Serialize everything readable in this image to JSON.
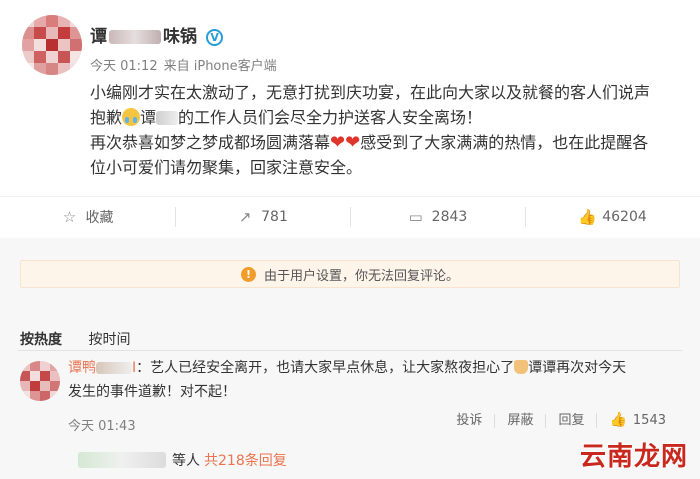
{
  "post": {
    "author_prefix": "谭",
    "author_middle": "味",
    "author_suffix": "锅",
    "verified_mark": "V",
    "time": "今天 01:12",
    "source": "来自 iPhone客户端",
    "lines": [
      "小编刚才实在太激动了，无意打扰到庆功宴，在此向大家以及就餐的客人们说声",
      "抱歉",
      "谭",
      "的工作人员们会尽全力护送客人安全离场！",
      "再次恭喜如梦之梦成都场圆满落幕",
      "感受到了大家满满的热情，也在此提醒各",
      "位小可爱们请勿聚集，回家注意安全。"
    ],
    "hearts": "❤❤"
  },
  "actions": {
    "favorite": "收藏",
    "repost": "781",
    "comment": "2843",
    "like": "46204"
  },
  "notice": {
    "text": "由于用户设置，你无法回复评论。"
  },
  "sort": {
    "hot": "按热度",
    "time": "按时间"
  },
  "comment": {
    "name_prefix": "谭鸭",
    "name_suffix": "I",
    "text_1": "：艺人已经安全离开，也请大家早点休息，让大家熬夜担心了",
    "text_2": "谭谭再次对今天",
    "text_3": "发生的事件道歉！对不起！",
    "time": "今天 01:43",
    "report": "投诉",
    "block": "屏蔽",
    "reply": "回复",
    "likes": "1543"
  },
  "replies": {
    "suffix": "等人",
    "count": "共218条回复"
  },
  "watermark": "云南龙网",
  "colors": {
    "accent": "#eb7350",
    "verified": "#2a9dd8",
    "notice_bg": "#fdf4ea",
    "warn": "#f29d2b"
  }
}
